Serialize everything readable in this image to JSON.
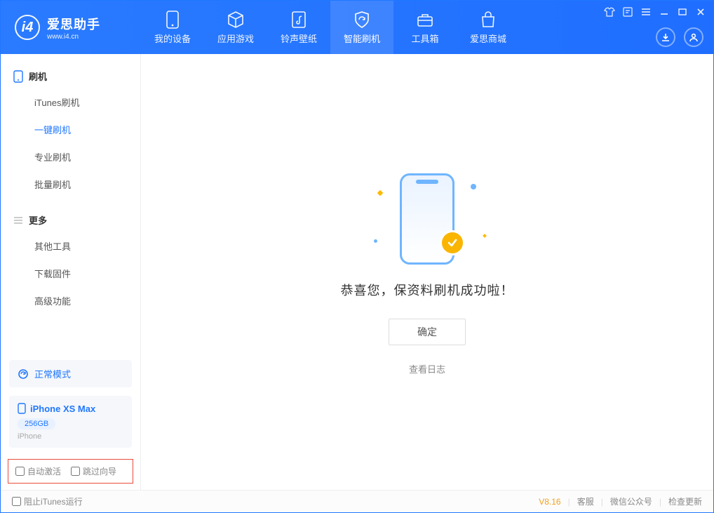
{
  "brand": {
    "name": "爱思助手",
    "site": "www.i4.cn"
  },
  "nav": {
    "my_device": "我的设备",
    "apps_games": "应用游戏",
    "ring_wall": "铃声壁纸",
    "smart_flash": "智能刷机",
    "toolbox": "工具箱",
    "store": "爱思商城"
  },
  "sidebar": {
    "group_flash": "刷机",
    "items_flash": {
      "itunes": "iTunes刷机",
      "one_key": "一键刷机",
      "pro": "专业刷机",
      "batch": "批量刷机"
    },
    "group_more": "更多",
    "items_more": {
      "other_tools": "其他工具",
      "download_firmware": "下载固件",
      "advanced": "高级功能"
    }
  },
  "mode": {
    "normal": "正常模式"
  },
  "device": {
    "name": "iPhone XS Max",
    "capacity": "256GB",
    "type": "iPhone"
  },
  "options": {
    "auto_activate": "自动激活",
    "skip_guide": "跳过向导"
  },
  "main": {
    "success_msg": "恭喜您，保资料刷机成功啦！",
    "ok": "确定",
    "view_log": "查看日志"
  },
  "footer": {
    "block_itunes": "阻止iTunes运行",
    "version": "V8.16",
    "support": "客服",
    "wechat": "微信公众号",
    "check_update": "检查更新"
  }
}
